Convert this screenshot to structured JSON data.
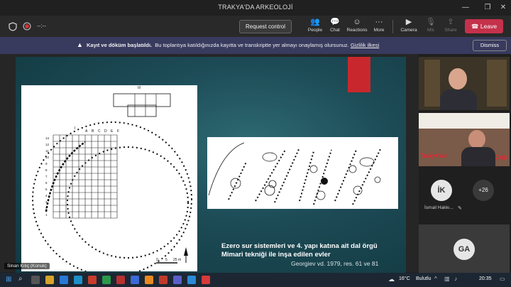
{
  "window": {
    "title": "TRAKYA'DA ARKEOLOJİ",
    "timer": "--:--"
  },
  "toolbar": {
    "request_control": "Request control",
    "items": [
      {
        "label": "People",
        "icon": "people-icon"
      },
      {
        "label": "Chat",
        "icon": "chat-icon"
      },
      {
        "label": "Reactions",
        "icon": "reactions-icon"
      },
      {
        "label": "More",
        "icon": "more-icon"
      },
      {
        "label": "Camera",
        "icon": "camera-icon"
      },
      {
        "label": "Mic",
        "icon": "mic-icon"
      },
      {
        "label": "Share",
        "icon": "share-icon"
      }
    ],
    "leave": "Leave"
  },
  "banner": {
    "bold": "Kayıt ve döküm başlatıldı.",
    "text": "Bu toplantıya katıldığınızda kayıtta ve transkriptte yer almayı onaylamış olursunuz.",
    "link": "Gizlilik ilkesi",
    "dismiss": "Dismiss"
  },
  "slide": {
    "caption_line1": "Ezero sur sistemleri ve 4. yapı katına ait dal örgü",
    "caption_line2": "Mimari tekniği ile inşa edilen evler",
    "reference": "Georgiev vd. 1979, res. 61 ve 81",
    "fig_grid_letters": [
      "A",
      "B",
      "C",
      "D",
      "E",
      "F"
    ],
    "fig_grid_numbers": [
      "13",
      "12",
      "11",
      "10",
      "9",
      "8",
      "7",
      "6",
      "5",
      "4",
      "3",
      "2",
      "1"
    ],
    "fig_scale": [
      "0",
      "5",
      "25 m"
    ],
    "fig_labels": [
      "III",
      "I"
    ]
  },
  "speaker_label": "Sinan Kılıç (Konuk)",
  "participants": {
    "tile2_text": "Trakya'nın",
    "tile2_text2": "Çağı",
    "ik_initials": "İK",
    "ik_name": "İsmail Hakkı...",
    "more_count": "+26",
    "ga_initials": "GA"
  },
  "taskbar": {
    "weather": "16°C",
    "weather_text": "Bulutlu",
    "time": "20:35"
  }
}
